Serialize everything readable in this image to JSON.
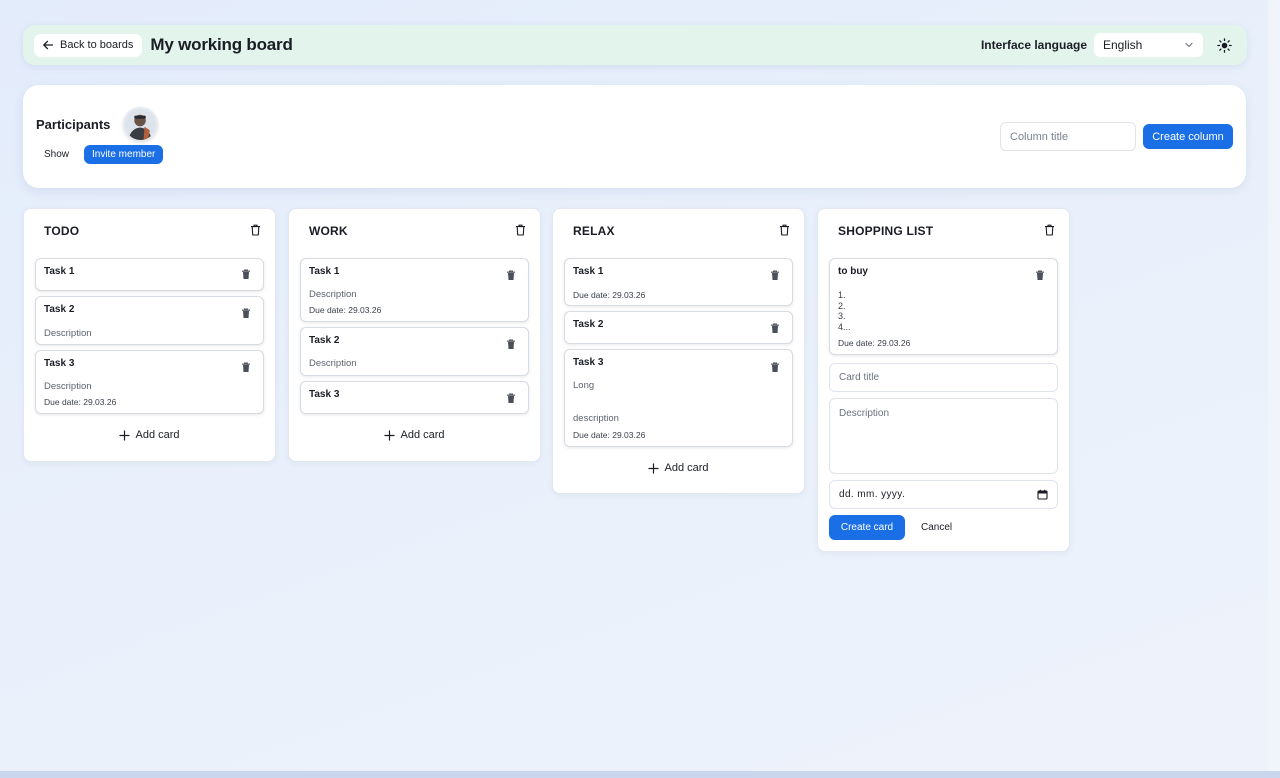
{
  "header": {
    "back_label": "Back to boards",
    "board_title": "My working board",
    "language_label": "Interface language",
    "language_value": "English"
  },
  "participants": {
    "label": "Participants",
    "show_label": "Show",
    "invite_label": "Invite member",
    "column_title_placeholder": "Column title",
    "create_column_label": "Create column"
  },
  "columns": [
    {
      "title": "TODO",
      "cards": [
        {
          "title": "Task 1",
          "description": "",
          "due": ""
        },
        {
          "title": "Task 2",
          "description": "Description",
          "due": ""
        },
        {
          "title": "Task 3",
          "description": "Description",
          "due": "Due date: 29.03.26"
        }
      ],
      "add_label": "Add card"
    },
    {
      "title": "WORK",
      "cards": [
        {
          "title": "Task 1",
          "description": "Description",
          "due": "Due date: 29.03.26"
        },
        {
          "title": "Task 2",
          "description": "Description",
          "due": ""
        },
        {
          "title": "Task 3",
          "description": "",
          "due": ""
        }
      ],
      "add_label": "Add card"
    },
    {
      "title": "RELAX",
      "cards": [
        {
          "title": "Task 1",
          "description": "",
          "due": "Due date: 29.03.26"
        },
        {
          "title": "Task 2",
          "description": "",
          "due": ""
        },
        {
          "title": "Task 3",
          "description": "Long\n\n\ndescription",
          "due": "Due date: 29.03.26"
        }
      ],
      "add_label": "Add card"
    },
    {
      "title": "SHOPPING LIST",
      "cards": [
        {
          "title": "to buy",
          "description": "1.\n2.\n3.\n4...",
          "due": "Due date: 29.03.26"
        }
      ],
      "form": {
        "card_title_placeholder": "Card title",
        "description_placeholder": "Description",
        "date_placeholder": "dd. mm. yyyy.",
        "create_label": "Create card",
        "cancel_label": "Cancel"
      }
    }
  ],
  "icons": {
    "back": "arrow-left-icon",
    "chevron": "chevron-down-icon",
    "theme": "sun-icon",
    "column_delete": "trash-outline-icon",
    "card_delete": "trash-icon",
    "add": "plus-icon",
    "calendar": "calendar-icon"
  },
  "colors": {
    "accent": "#1a6fe6",
    "header_bg": "#e2f4ec",
    "page_bg": "#e6eefb"
  }
}
